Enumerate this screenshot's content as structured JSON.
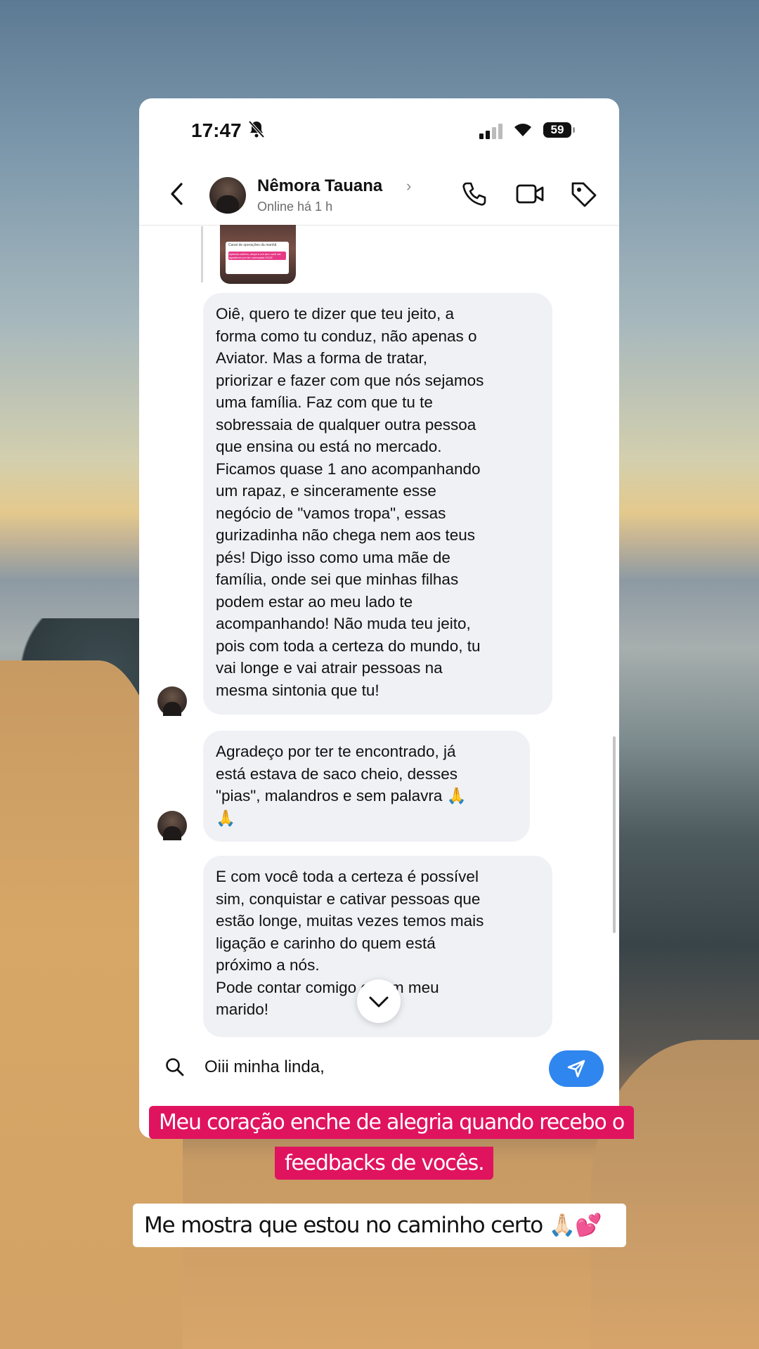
{
  "status_bar": {
    "time": "17:47",
    "battery": "59"
  },
  "chat_header": {
    "contact_name": "Nêmora Tauana",
    "presence": "Online há 1 h",
    "chevron": "›"
  },
  "shared_post": {
    "card_line1": "Canal de operações da manhã",
    "card_line2": "Apenas carinho, daqui a um ano você vai agradecer por ter começado HOJE"
  },
  "messages": [
    {
      "text": "Oiê, quero te dizer que teu jeito, a\nforma como tu conduz, não apenas o\nAviator. Mas a forma de tratar,\npriorizar e fazer com que nós sejamos\numa família. Faz com que tu te\nsobressaia de qualquer outra pessoa\nque ensina ou está no mercado.\nFicamos quase 1 ano acompanhando\num rapaz, e sinceramente esse\nnegócio de \"vamos tropa\", essas\ngurizadinha não chega nem aos teus\npés! Digo isso como uma mãe de\nfamília, onde sei que minhas filhas\npodem estar ao meu lado te\nacompanhando! Não muda teu jeito,\npois com toda a certeza do mundo, tu\nvai longe e vai atrair pessoas na\nmesma sintonia que tu!"
    },
    {
      "text": "Agradeço por ter te encontrado, já\nestá estava de saco cheio, desses\n\"pias\", malandros e sem palavra 🙏\n🙏"
    },
    {
      "text": "E com você toda a certeza é possível\nsim, conquistar e cativar pessoas que\nestão longe, muitas vezes temos mais\nligação e carinho do quem está\npróximo a nós.\nPode contar comigo e com meu\nmarido!"
    }
  ],
  "composer": {
    "text": "Oiii  minha linda,"
  },
  "captions": {
    "line1": "Meu coração enche de alegria quando recebo o",
    "line2": "feedbacks de vocês.",
    "line3": "Me mostra que estou no caminho certo 🙏🏻💕"
  },
  "colors": {
    "caption_bg": "#e0135e",
    "send_button": "#2f86ef",
    "bubble_bg": "#eff1f5"
  }
}
